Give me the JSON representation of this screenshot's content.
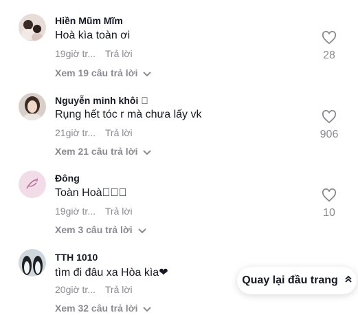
{
  "comments": [
    {
      "author": "Hiền Mũm Mĩm",
      "text": "Hoà kìa toàn ơi",
      "time": "19giờ tr...",
      "reply_label": "Trả lời",
      "likes": "28",
      "view_replies": "Xem 19 câu trả lời"
    },
    {
      "author": "Nguyễn minh khôi ⃞",
      "text": "Rụng hết tóc r mà chưa lấy vk",
      "time": "21giờ tr...",
      "reply_label": "Trả lời",
      "likes": "906",
      "view_replies": "Xem 21 câu trả lời"
    },
    {
      "author": "Đông",
      "text": "Toàn Hoà⃞⃞⃞",
      "time": "19giờ tr...",
      "reply_label": "Trả lời",
      "likes": "10",
      "view_replies": "Xem 3 câu trả lời"
    },
    {
      "author": "TTH 1010",
      "text": "tìm đi đâu xa Hòa kìa❤",
      "time": "20giờ tr...",
      "reply_label": "Trả lời",
      "likes": "",
      "view_replies": "Xem 32 câu trả lời"
    }
  ],
  "back_to_top": "Quay lại đầu trang"
}
